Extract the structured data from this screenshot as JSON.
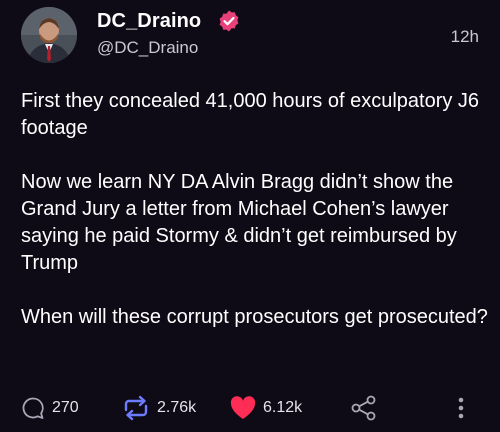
{
  "author": {
    "display_name": "DC_Draino",
    "handle": "@DC_Draino",
    "verified": true,
    "timestamp": "12h"
  },
  "post": {
    "paragraphs": [
      "First they concealed 41,000 hours of exculpatory J6 footage",
      "Now we learn NY DA Alvin Bragg didn’t show the Grand Jury a letter from Michael Cohen’s lawyer saying he paid Stormy & didn’t get reimbursed by Trump",
      "When will these corrupt prosecutors get prosecuted?"
    ]
  },
  "actions": {
    "replies": "270",
    "reposts": "2.76k",
    "likes": "6.12k"
  },
  "colors": {
    "background": "#0e0b16",
    "verified_badge": "#e8417a",
    "like_heart": "#ff2d55",
    "icon_gray": "#a9a6b6"
  },
  "icons": {
    "verified": "verified-badge-icon",
    "reply": "reply-bubble-icon",
    "repost": "repost-arrows-icon",
    "like": "heart-icon",
    "share": "share-icon",
    "more": "more-vertical-icon"
  }
}
